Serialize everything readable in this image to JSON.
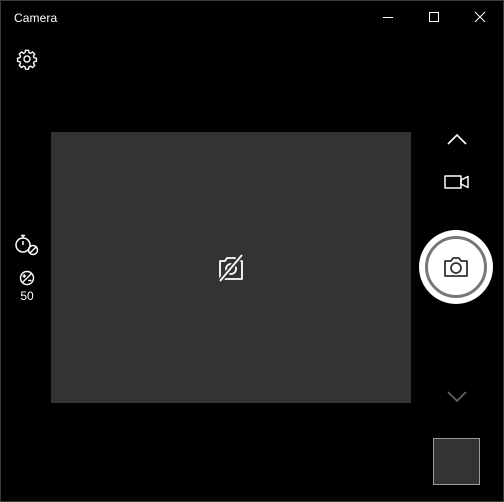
{
  "window": {
    "title": "Camera",
    "controls": {
      "minimize_icon": "minimize-icon",
      "maximize_icon": "maximize-icon",
      "close_icon": "close-icon"
    }
  },
  "toolbar_left": {
    "settings_icon": "gear-icon",
    "timer_icon": "timer-off-icon",
    "exposure_icon": "exposure-icon",
    "exposure_value": "50"
  },
  "viewfinder": {
    "status_icon": "camera-unavailable-icon"
  },
  "toolbar_right": {
    "mode_up_icon": "chevron-up-icon",
    "video_mode_icon": "video-camera-icon",
    "shutter_icon": "camera-icon",
    "mode_down_icon": "chevron-down-icon"
  },
  "colors": {
    "background": "#000000",
    "viewfinder": "#333333",
    "foreground": "#ffffff",
    "shutter_ring": "#777777"
  }
}
